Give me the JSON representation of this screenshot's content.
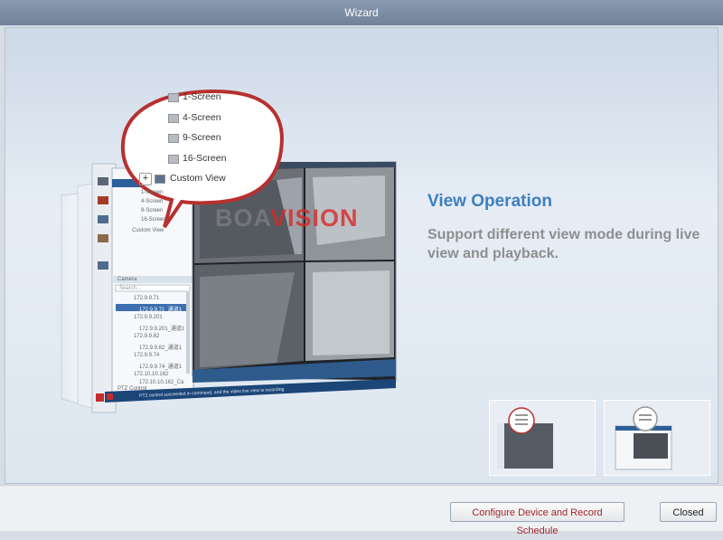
{
  "window": {
    "title": "Wizard"
  },
  "main": {
    "heading": "View Operation",
    "description": "Support different view mode during live view and playback."
  },
  "screenshot": {
    "layout_menu": [
      "1-Screen",
      "4-Screen",
      "9-Screen",
      "16-Screen",
      "Custom View"
    ],
    "tree_items": [
      "1-Screen",
      "4-Screen",
      "9-Screen",
      "16-Screen",
      "Custom View"
    ],
    "camera_header": "Camera",
    "search_placeholder": "Search...",
    "camera_items": [
      "172.9.9.71",
      "172.9.9.71_通道1",
      "172.9.9.201",
      "172.9.9.201_通道1",
      "172.9.9.62",
      "172.9.9.62_通道1",
      "172.9.9.74",
      "172.9.9.74_通道1",
      "172.10.10.162",
      "172.10.10.162_Ca"
    ],
    "ptz_label": "PTZ Control",
    "status_text": "PTZ control succeeded in command, and the video live view is recording"
  },
  "watermark": {
    "part1": "BOA",
    "part2": "VISION"
  },
  "footer": {
    "configure_label": "Configure Device and Record Schedule",
    "closed_label": "Closed"
  }
}
